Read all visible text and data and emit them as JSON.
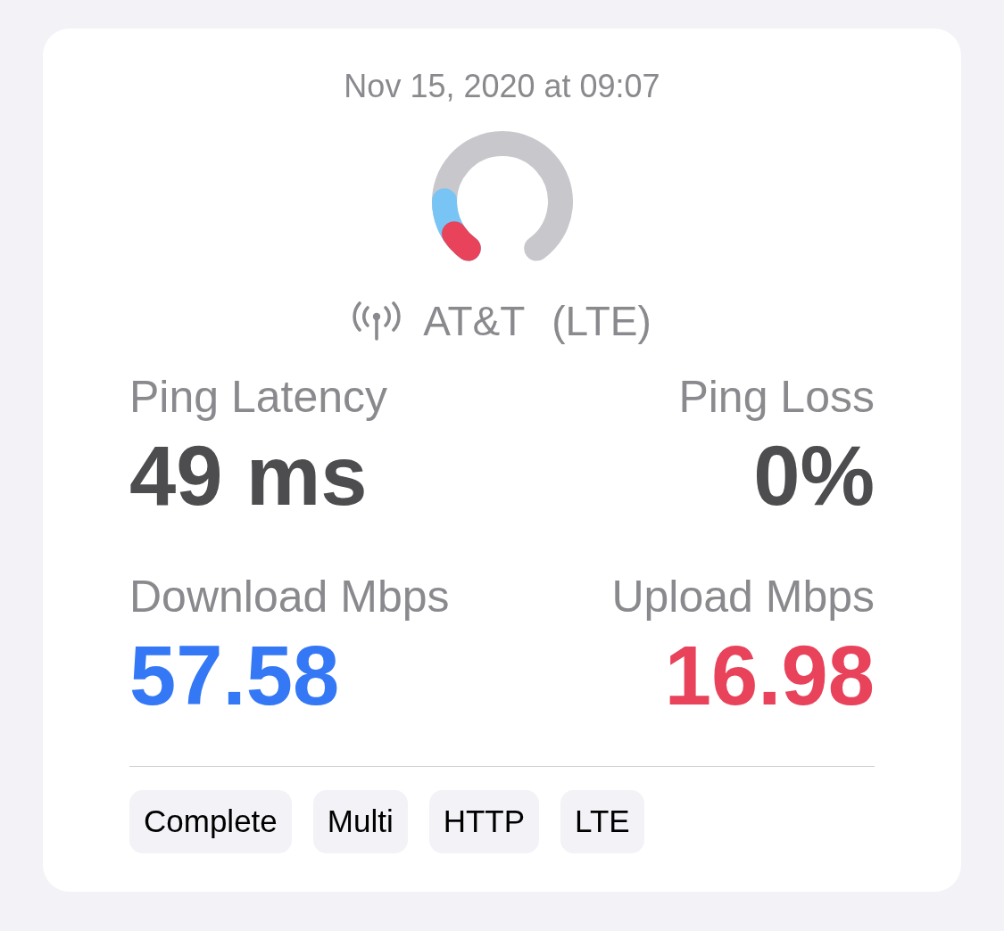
{
  "card": {
    "timestamp": "Nov 15, 2020 at 09:07",
    "gauge": {
      "arcs": [
        {
          "level": 0.19,
          "color": "#78c5f5"
        },
        {
          "level": 0.07,
          "color": "#e8435a"
        }
      ]
    },
    "network": {
      "carrier": "AT&T",
      "technology": "(LTE)"
    },
    "metrics": [
      {
        "label": "Ping Latency",
        "value": "49 ms",
        "color": "#4d4d4f"
      },
      {
        "label": "Ping Loss",
        "value": "0%",
        "color": "#4d4d4f"
      },
      {
        "label": "Download Mbps",
        "value": "57.58",
        "color": "#3478f6"
      },
      {
        "label": "Upload Mbps",
        "value": "16.98",
        "color": "#e8435a"
      }
    ],
    "tags": [
      "Complete",
      "Multi",
      "HTTP",
      "LTE"
    ]
  }
}
